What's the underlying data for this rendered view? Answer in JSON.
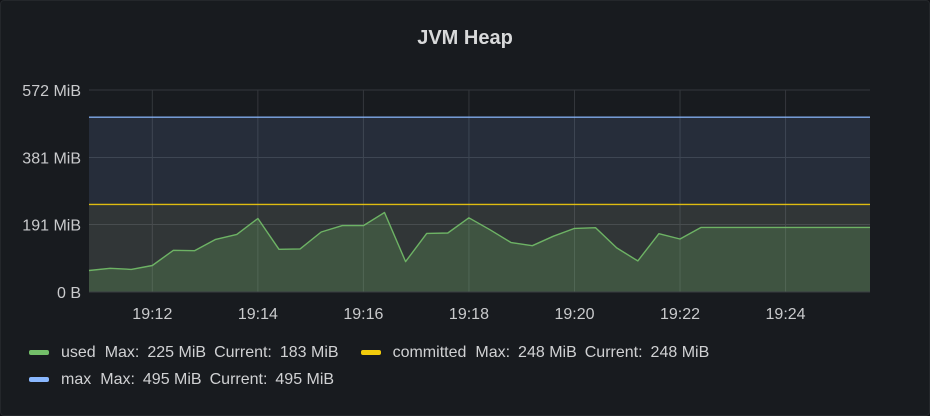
{
  "chart_data": {
    "type": "area",
    "title": "JVM Heap",
    "ylabel": "",
    "xlabel": "",
    "y_unit": "MiB",
    "ylim": [
      0,
      572
    ],
    "y_ticks": [
      {
        "value": 0,
        "label": "0 B"
      },
      {
        "value": 191,
        "label": "191 MiB"
      },
      {
        "value": 381,
        "label": "381 MiB"
      },
      {
        "value": 572,
        "label": "572 MiB"
      }
    ],
    "xlim": [
      "19:10:48",
      "19:25:36"
    ],
    "x_ticks": [
      "19:12",
      "19:14",
      "19:16",
      "19:18",
      "19:20",
      "19:22",
      "19:24"
    ],
    "grid": true,
    "legend_position": "bottom",
    "series": [
      {
        "name": "used",
        "color": "#73bf69",
        "stats": {
          "max_label": "Max:",
          "max": "225 MiB",
          "current_label": "Current:",
          "current": "183 MiB"
        },
        "x": [
          "19:10:48",
          "19:11:12",
          "19:11:36",
          "19:12:00",
          "19:12:24",
          "19:12:48",
          "19:13:12",
          "19:13:36",
          "19:14:00",
          "19:14:24",
          "19:14:48",
          "19:15:12",
          "19:15:36",
          "19:16:00",
          "19:16:24",
          "19:16:48",
          "19:17:12",
          "19:17:36",
          "19:18:00",
          "19:18:24",
          "19:18:48",
          "19:19:12",
          "19:19:36",
          "19:20:00",
          "19:20:24",
          "19:20:48",
          "19:21:12",
          "19:21:36",
          "19:22:00",
          "19:22:24",
          "19:22:48",
          "19:23:12",
          "19:23:36",
          "19:24:00",
          "19:24:24",
          "19:24:48",
          "19:25:12",
          "19:25:36"
        ],
        "values": [
          61,
          67,
          64,
          75,
          118,
          117,
          149,
          163,
          208,
          121,
          122,
          170,
          188,
          188,
          225,
          86,
          166,
          167,
          210,
          176,
          140,
          131,
          158,
          180,
          182,
          125,
          88,
          165,
          150,
          183,
          183,
          183,
          183,
          183,
          183,
          183,
          183,
          183
        ]
      },
      {
        "name": "committed",
        "color": "#f2cc0c",
        "stats": {
          "max_label": "Max:",
          "max": "248 MiB",
          "current_label": "Current:",
          "current": "248 MiB"
        },
        "x": [
          "19:10:48",
          "19:25:36"
        ],
        "values": [
          248,
          248
        ]
      },
      {
        "name": "max",
        "color": "#8ab8ff",
        "stats": {
          "max_label": "Max:",
          "max": "495 MiB",
          "current_label": "Current:",
          "current": "495 MiB"
        },
        "x": [
          "19:10:48",
          "19:25:36"
        ],
        "values": [
          495,
          495
        ]
      }
    ]
  }
}
